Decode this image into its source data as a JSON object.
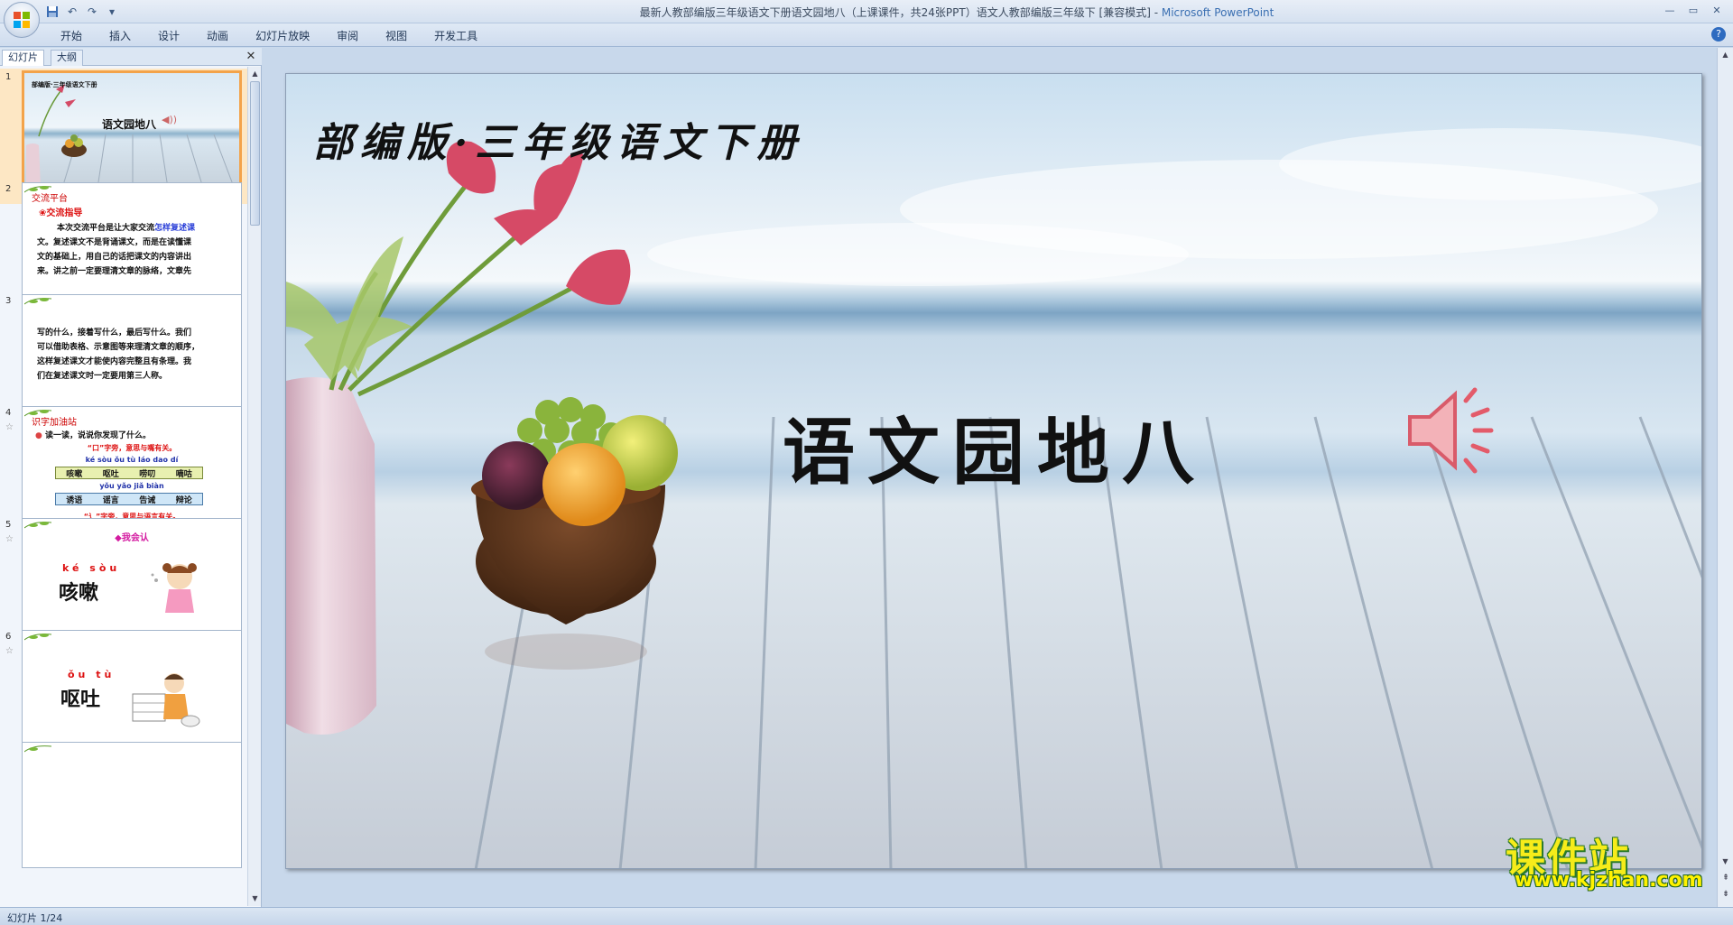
{
  "window": {
    "title": "最新人教部编版三年级语文下册语文园地八（上课课件，共24张PPT）语文人教部编版三年级下 [兼容模式] - ",
    "app_name": "Microsoft PowerPoint"
  },
  "quick_access": {
    "save_icon": "save-icon",
    "undo_icon": "undo-icon",
    "redo_icon": "redo-icon",
    "customize_icon": "dropdown-icon"
  },
  "ribbon": {
    "tabs": [
      "开始",
      "插入",
      "设计",
      "动画",
      "幻灯片放映",
      "审阅",
      "视图",
      "开发工具"
    ]
  },
  "left_pane": {
    "tab_slides": "幻灯片",
    "tab_outline": "大纲",
    "thumbnails": [
      {
        "num": "1",
        "header": "部编版·三年级语文下册",
        "title": "语文园地八"
      },
      {
        "num": "2",
        "header": "交流平台",
        "sub": "❀交流指导",
        "lines": [
          "本次交流平台是让大家交流怎样复述课",
          "文。复述课文不是背诵课文，而是在读懂课",
          "文的基础上，用自己的话把课文的内容讲出",
          "来。讲之前一定要理清文章的脉络，文章先"
        ],
        "blue": "怎样复述课"
      },
      {
        "num": "3",
        "lines": [
          "写的什么，接着写什么，最后写什么。我们",
          "可以借助表格、示意图等来理清文章的顺序，",
          "这样复述课文才能使内容完整且有条理。我",
          "们在复述课文时一定要用第三人称。"
        ]
      },
      {
        "num": "4",
        "header": "识字加油站",
        "intro": "读一读，说说你发现了什么。",
        "note1": "“口”字旁，意思与嘴有关。",
        "pinyin1": "ké sòu ǒu tù láo dao dí",
        "words1": [
          "咳嗽",
          "呕吐",
          "唠叨",
          "嘀咕"
        ],
        "pinyin2": "yǒu yǎo jiǎ biàn",
        "words2": [
          "诱语",
          "谣言",
          "告诫",
          "辩论"
        ],
        "note2": "“讠”字旁，意思与语言有关。"
      },
      {
        "num": "5",
        "header": "◆我会认",
        "pinyin": "ké sòu",
        "word": "咳嗽"
      },
      {
        "num": "6",
        "pinyin": "ǒu tù",
        "word": "呕吐"
      }
    ]
  },
  "slide": {
    "header": "部编版·三年级语文下册",
    "title": "语文园地八",
    "speaker_icon": "speaker-icon"
  },
  "watermark": {
    "text": "课件站",
    "url": "www.kjzhan.com"
  },
  "statusbar": {
    "slide_count": "幻灯片 1/24"
  },
  "colors": {
    "accent": "#f3a34a",
    "ribbon": "#cfdcee",
    "title_link": "#3a6fb2"
  }
}
